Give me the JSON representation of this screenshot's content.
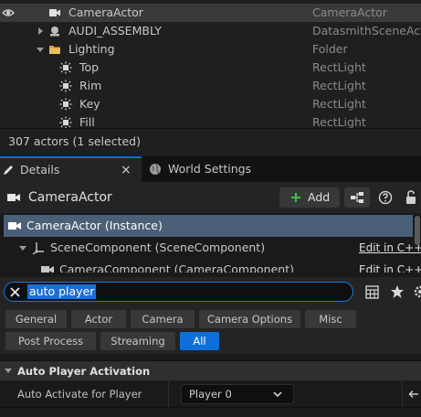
{
  "outliner": {
    "rows": [
      {
        "label": "CameraActor",
        "type": "CameraActor"
      },
      {
        "label": "AUDI_ASSEMBLY",
        "type": "DatasmithSceneAct"
      },
      {
        "label": "Lighting",
        "type": "Folder"
      },
      {
        "label": "Top",
        "type": "RectLight"
      },
      {
        "label": "Rim",
        "type": "RectLight"
      },
      {
        "label": "Key",
        "type": "RectLight"
      },
      {
        "label": "Fill",
        "type": "RectLight"
      }
    ],
    "actor_count": "307 actors (1 selected)"
  },
  "tabs": {
    "details": "Details",
    "world_settings": "World Settings",
    "close": "×"
  },
  "details": {
    "actor_name": "CameraActor",
    "add_label": "Add"
  },
  "components": [
    {
      "label": "CameraActor (Instance)"
    },
    {
      "label": "SceneComponent (SceneComponent)",
      "edit": "Edit in C++"
    },
    {
      "label": "CameraComponent (CameraComponent)",
      "edit": "Edit in C++"
    }
  ],
  "search": {
    "value": "auto player"
  },
  "filters": {
    "row1": [
      "General",
      "Actor",
      "Camera",
      "Camera Options",
      "Misc"
    ],
    "row2": [
      "Post Process",
      "Streaming",
      "All"
    ],
    "active": "All"
  },
  "section": {
    "title": "Auto Player Activation",
    "property_label": "Auto Activate for Player",
    "property_value": "Player 0"
  },
  "colors": {
    "accent": "#0f6fd8",
    "selection": "#4a5f78"
  }
}
